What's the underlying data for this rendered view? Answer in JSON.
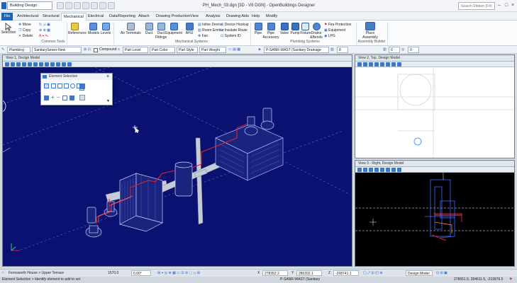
{
  "titlebar": {
    "workspace": "Building Design",
    "document_title": "PH_Mech_03.dgn [3D - V8 DGN] - OpenBuildings Designer",
    "search_placeholder": "Search Ribbon (F4)"
  },
  "tabs": [
    "File",
    "Architectural",
    "Structural",
    "Mechanical",
    "Electrical",
    "Data/Reporting",
    "Attach",
    "Drawing Production",
    "View",
    "Analysis",
    "Drawing Aids",
    "Help",
    "Modify"
  ],
  "active_tab": "Mechanical",
  "ribbon": {
    "selection_label": "Selection",
    "move": "Move",
    "copy": "Copy",
    "delete": "Delete",
    "common_tools": "Common Tools",
    "references": "References",
    "models": "Models",
    "levels": "Levels",
    "air_terminals": "Air Terminals",
    "duct": "Duct",
    "duct_fittings": "Duct Fittings",
    "equipment": "Equipment",
    "ahu": "AHU",
    "fan": "Fan",
    "inline_device": "Inline Device",
    "room_emitter": "Room Emitter",
    "device_hookup": "Device Hookup",
    "insulate_route": "Insulate Route",
    "system_id": "System ID",
    "mechanical_systems": "Mechanical Systems",
    "pipe": "Pipe",
    "pipe_accessory": "Pipe Accessory",
    "valve": "Valve",
    "pump": "Pump",
    "fixture": "Fixture",
    "drains_bends": "Drains &Bends",
    "fire_protection": "Fire Protection",
    "equipment2": "Equipment",
    "lpg": "LPG",
    "plumbing_systems": "Plumbing Systems",
    "place_assembly": "Place Assembly",
    "assembly_builder": "Assembly Builder"
  },
  "attributes": {
    "discipline": "Plumbing",
    "system": "SanitarySewer-New",
    "compound": "Compound",
    "part_level": "Part Level",
    "part_color": "Part Color",
    "part_style": "Part Style",
    "part_weight": "Part Weight",
    "spec": "P-SANR-WAST (Sanitary Drainage",
    "count1": "8",
    "count2": "0",
    "count3": "0"
  },
  "views": {
    "view1_title": "View 1, Design Model",
    "view2_title": "View 2, Top, Design Model",
    "view3_title": "View 3 - Right, Design Model"
  },
  "dialog": {
    "title": "Element Selection"
  },
  "status": {
    "location": "Fernsworth House > Upper Terrace",
    "scale": "1570.0",
    "angle": "0.00°",
    "x_value": "278352.2",
    "y_value": "280202.1",
    "z_value": "-208741.1",
    "model": "Design Model",
    "message": "Element Selection > Identify element to add to set",
    "spec": "P-SANR-WAST (Sanitary",
    "coords": "278651.5, 284611.5, -219976.5"
  },
  "colors": {
    "accent": "#1f63b5",
    "viewport_bg": "#0b1170",
    "pipe_red": "#e0202a",
    "fixture_outline": "#9fb8ff"
  }
}
